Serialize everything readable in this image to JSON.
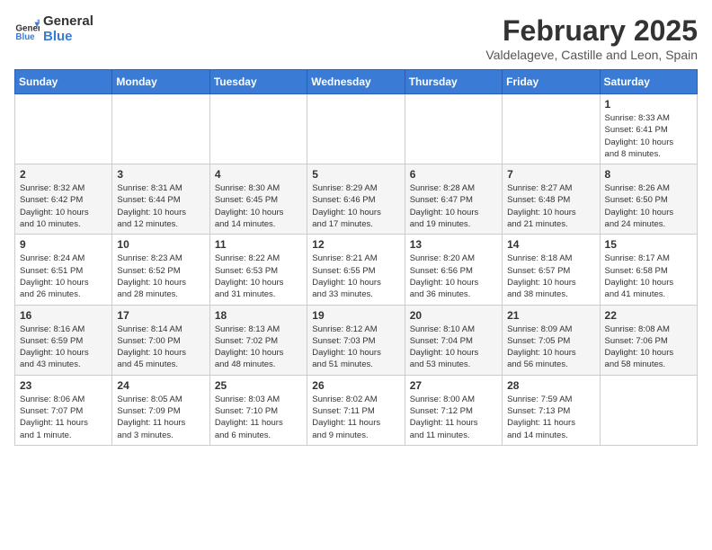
{
  "header": {
    "logo_line1": "General",
    "logo_line2": "Blue",
    "month_title": "February 2025",
    "subtitle": "Valdelageve, Castille and Leon, Spain"
  },
  "weekdays": [
    "Sunday",
    "Monday",
    "Tuesday",
    "Wednesday",
    "Thursday",
    "Friday",
    "Saturday"
  ],
  "weeks": [
    [
      {
        "day": "",
        "info": ""
      },
      {
        "day": "",
        "info": ""
      },
      {
        "day": "",
        "info": ""
      },
      {
        "day": "",
        "info": ""
      },
      {
        "day": "",
        "info": ""
      },
      {
        "day": "",
        "info": ""
      },
      {
        "day": "1",
        "info": "Sunrise: 8:33 AM\nSunset: 6:41 PM\nDaylight: 10 hours\nand 8 minutes."
      }
    ],
    [
      {
        "day": "2",
        "info": "Sunrise: 8:32 AM\nSunset: 6:42 PM\nDaylight: 10 hours\nand 10 minutes."
      },
      {
        "day": "3",
        "info": "Sunrise: 8:31 AM\nSunset: 6:44 PM\nDaylight: 10 hours\nand 12 minutes."
      },
      {
        "day": "4",
        "info": "Sunrise: 8:30 AM\nSunset: 6:45 PM\nDaylight: 10 hours\nand 14 minutes."
      },
      {
        "day": "5",
        "info": "Sunrise: 8:29 AM\nSunset: 6:46 PM\nDaylight: 10 hours\nand 17 minutes."
      },
      {
        "day": "6",
        "info": "Sunrise: 8:28 AM\nSunset: 6:47 PM\nDaylight: 10 hours\nand 19 minutes."
      },
      {
        "day": "7",
        "info": "Sunrise: 8:27 AM\nSunset: 6:48 PM\nDaylight: 10 hours\nand 21 minutes."
      },
      {
        "day": "8",
        "info": "Sunrise: 8:26 AM\nSunset: 6:50 PM\nDaylight: 10 hours\nand 24 minutes."
      }
    ],
    [
      {
        "day": "9",
        "info": "Sunrise: 8:24 AM\nSunset: 6:51 PM\nDaylight: 10 hours\nand 26 minutes."
      },
      {
        "day": "10",
        "info": "Sunrise: 8:23 AM\nSunset: 6:52 PM\nDaylight: 10 hours\nand 28 minutes."
      },
      {
        "day": "11",
        "info": "Sunrise: 8:22 AM\nSunset: 6:53 PM\nDaylight: 10 hours\nand 31 minutes."
      },
      {
        "day": "12",
        "info": "Sunrise: 8:21 AM\nSunset: 6:55 PM\nDaylight: 10 hours\nand 33 minutes."
      },
      {
        "day": "13",
        "info": "Sunrise: 8:20 AM\nSunset: 6:56 PM\nDaylight: 10 hours\nand 36 minutes."
      },
      {
        "day": "14",
        "info": "Sunrise: 8:18 AM\nSunset: 6:57 PM\nDaylight: 10 hours\nand 38 minutes."
      },
      {
        "day": "15",
        "info": "Sunrise: 8:17 AM\nSunset: 6:58 PM\nDaylight: 10 hours\nand 41 minutes."
      }
    ],
    [
      {
        "day": "16",
        "info": "Sunrise: 8:16 AM\nSunset: 6:59 PM\nDaylight: 10 hours\nand 43 minutes."
      },
      {
        "day": "17",
        "info": "Sunrise: 8:14 AM\nSunset: 7:00 PM\nDaylight: 10 hours\nand 45 minutes."
      },
      {
        "day": "18",
        "info": "Sunrise: 8:13 AM\nSunset: 7:02 PM\nDaylight: 10 hours\nand 48 minutes."
      },
      {
        "day": "19",
        "info": "Sunrise: 8:12 AM\nSunset: 7:03 PM\nDaylight: 10 hours\nand 51 minutes."
      },
      {
        "day": "20",
        "info": "Sunrise: 8:10 AM\nSunset: 7:04 PM\nDaylight: 10 hours\nand 53 minutes."
      },
      {
        "day": "21",
        "info": "Sunrise: 8:09 AM\nSunset: 7:05 PM\nDaylight: 10 hours\nand 56 minutes."
      },
      {
        "day": "22",
        "info": "Sunrise: 8:08 AM\nSunset: 7:06 PM\nDaylight: 10 hours\nand 58 minutes."
      }
    ],
    [
      {
        "day": "23",
        "info": "Sunrise: 8:06 AM\nSunset: 7:07 PM\nDaylight: 11 hours\nand 1 minute."
      },
      {
        "day": "24",
        "info": "Sunrise: 8:05 AM\nSunset: 7:09 PM\nDaylight: 11 hours\nand 3 minutes."
      },
      {
        "day": "25",
        "info": "Sunrise: 8:03 AM\nSunset: 7:10 PM\nDaylight: 11 hours\nand 6 minutes."
      },
      {
        "day": "26",
        "info": "Sunrise: 8:02 AM\nSunset: 7:11 PM\nDaylight: 11 hours\nand 9 minutes."
      },
      {
        "day": "27",
        "info": "Sunrise: 8:00 AM\nSunset: 7:12 PM\nDaylight: 11 hours\nand 11 minutes."
      },
      {
        "day": "28",
        "info": "Sunrise: 7:59 AM\nSunset: 7:13 PM\nDaylight: 11 hours\nand 14 minutes."
      },
      {
        "day": "",
        "info": ""
      }
    ]
  ]
}
